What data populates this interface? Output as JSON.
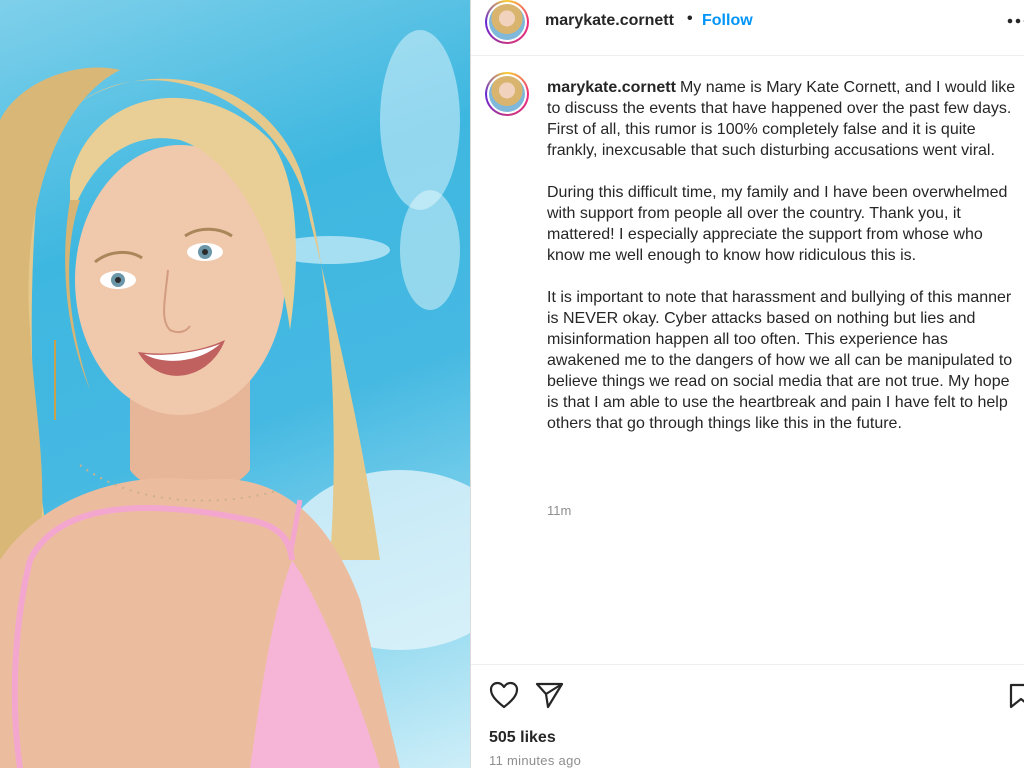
{
  "header": {
    "username": "marykate.cornett",
    "separator": "•",
    "follow_label": "Follow",
    "more_icon": "more-horizontal-icon"
  },
  "caption": {
    "username": "marykate.cornett",
    "paragraphs": [
      "My name is Mary Kate Cornett, and I would like to discuss the events that have happened over the past few days. First of all, this rumor is 100% completely false and it is quite frankly, inexcusable that such disturbing accusations went viral.",
      "During this difficult time, my family and I have been overwhelmed with support from people all over the country. Thank you, it mattered! I especially appreciate the support from whose who know me well enough to know how ridiculous this is.",
      "It is important to note that harassment and bullying of this manner is NEVER okay. Cyber attacks based on nothing but lies and misinformation happen all too often. This experience has awakened me to the dangers of how we all can be manipulated to believe things we read on social media that are not true. My hope is that I am able to use the heartbreak and pain I have felt to help others that go through things like this in the future."
    ],
    "time": "11m"
  },
  "footer": {
    "like_icon": "heart-icon",
    "share_icon": "paper-plane-icon",
    "save_icon": "bookmark-icon",
    "likes": "505 likes",
    "timestamp": "11 minutes ago"
  },
  "colors": {
    "accent": "#0095f6",
    "text": "#262626",
    "muted": "#8e8e8e"
  }
}
